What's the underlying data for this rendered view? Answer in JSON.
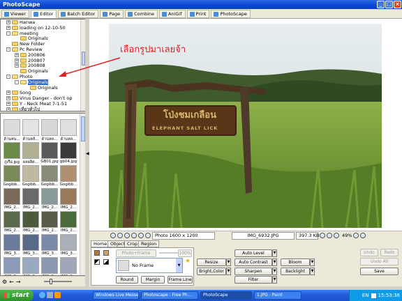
{
  "window": {
    "title": "PhotoScape"
  },
  "tabs": [
    {
      "label": "Viewer"
    },
    {
      "label": "Editor"
    },
    {
      "label": "Batch Editor"
    },
    {
      "label": "Page"
    },
    {
      "label": "Combine"
    },
    {
      "label": "AniGif"
    },
    {
      "label": "Print"
    },
    {
      "label": "PhotoScape"
    }
  ],
  "tree": [
    {
      "label": "Hanwa",
      "expander": "+"
    },
    {
      "label": "loading on 12-10-50",
      "expander": "+"
    },
    {
      "label": "meeting",
      "expander": "-"
    },
    {
      "label": "Originals",
      "expander": ""
    },
    {
      "label": "New Folder",
      "expander": ""
    },
    {
      "label": "Pc Review",
      "expander": "-"
    },
    {
      "label": "200806",
      "expander": "+"
    },
    {
      "label": "200807",
      "expander": "+"
    },
    {
      "label": "200808",
      "expander": "+"
    },
    {
      "label": "Originals",
      "expander": ""
    },
    {
      "label": "Photo",
      "expander": "-"
    },
    {
      "label": "Originals",
      "expander": "-"
    },
    {
      "label": "Originals",
      "expander": ""
    },
    {
      "label": "Song",
      "expander": "+"
    },
    {
      "label": "Virus Danger - don't op",
      "expander": "+"
    },
    {
      "label": "Y - Neck Meat 7-1-51",
      "expander": "+"
    },
    {
      "label": "เที่ยวทั่วไป",
      "expander": "+"
    }
  ],
  "thumbnails": [
    {
      "label": "ด้านหน...",
      "tone": "#dcdcdc"
    },
    {
      "label": "ด้านหลั...",
      "tone": "#e4e4e4"
    },
    {
      "label": "ด้านหล...",
      "tone": "#d8d8d8"
    },
    {
      "label": "ด้านหล...",
      "tone": "#e0e0e0"
    },
    {
      "label": "ภูเรือ.jpg",
      "tone": "#6a8a4a"
    },
    {
      "label": "ผลผลิต...",
      "tone": "#b0b090"
    },
    {
      "label": "GB01.jpg",
      "tone": "#5a5a5a"
    },
    {
      "label": "gb04.jpg",
      "tone": "#3a3a3a"
    },
    {
      "label": "Gogibb...",
      "tone": "#7a8a5a"
    },
    {
      "label": "Gogibb...",
      "tone": "#c0b8a0"
    },
    {
      "label": "Gogibb...",
      "tone": "#8a8a7a"
    },
    {
      "label": "Gogibb...",
      "tone": "#b09070"
    },
    {
      "label": "IMG_2...",
      "tone": "#7a6a5a"
    },
    {
      "label": "IMG_2...",
      "tone": "#6a6a6a"
    },
    {
      "label": "IMG_2...",
      "tone": "#8a9a9a"
    },
    {
      "label": "IMG_2...",
      "tone": "#9a7a5a"
    },
    {
      "label": "IMG_2...",
      "tone": "#5a6a4a"
    },
    {
      "label": "IMG_2...",
      "tone": "#4a5a3a"
    },
    {
      "label": "IMG_2...",
      "tone": "#5a5a4a"
    },
    {
      "label": "IMG_2...",
      "tone": "#4a6a3a"
    },
    {
      "label": "IMG_3...",
      "tone": "#6a7a9a"
    },
    {
      "label": "IMG_3...",
      "tone": "#5a6a8a"
    },
    {
      "label": "IMG_3...",
      "tone": "#7a8aaa"
    },
    {
      "label": "IMG_3...",
      "tone": "#aab0b8"
    },
    {
      "label": "IMG_3...",
      "tone": "#8a9ab8"
    },
    {
      "label": "IMG_3...",
      "tone": "#9aa8c0"
    },
    {
      "label": "IMG_3...",
      "tone": "#8a98b0"
    },
    {
      "label": "IMG_3...",
      "tone": "#a0a8b8"
    }
  ],
  "annotation": "เลือกรูปมาเลยจ้า",
  "sign": {
    "thai": "โป่งชมเกลือน",
    "english": "ELEPHANT SALT LICK"
  },
  "infobar": {
    "photo_size": "Photo 1600 x 1200",
    "filename": "IMG_6932.JPG",
    "filesize": "397.3 KB",
    "zoom": "49%"
  },
  "edit_tabs": [
    "Home",
    "Object",
    "Crop",
    "Region"
  ],
  "home": {
    "photo_frame": "Photo+Frame",
    "frame_pct": "100%",
    "frame_select": "No Frame",
    "round": "Round",
    "margin": "Margin",
    "frame_line": "Frame Line"
  },
  "tools": {
    "resize": "Resize",
    "bright_color": "Bright,Color",
    "auto_level": "Auto Level",
    "auto_contrast": "Auto Contrast",
    "sharpen": "Sharpen",
    "filter": "Filter",
    "bloom": "Bloom",
    "backlight": "Backlight"
  },
  "actions": {
    "undo": "Undo",
    "redo": "Redo",
    "undo_all": "Undo All",
    "save": "Save"
  },
  "taskbar": {
    "start": "start",
    "tasks": [
      {
        "label": "Windows Live Messen..."
      },
      {
        "label": "Photoscape : Free Ph..."
      },
      {
        "label": "PhotoScape"
      },
      {
        "label": "1.JPG - Paint"
      }
    ],
    "lang": "EN",
    "clock": "15:53:36"
  }
}
